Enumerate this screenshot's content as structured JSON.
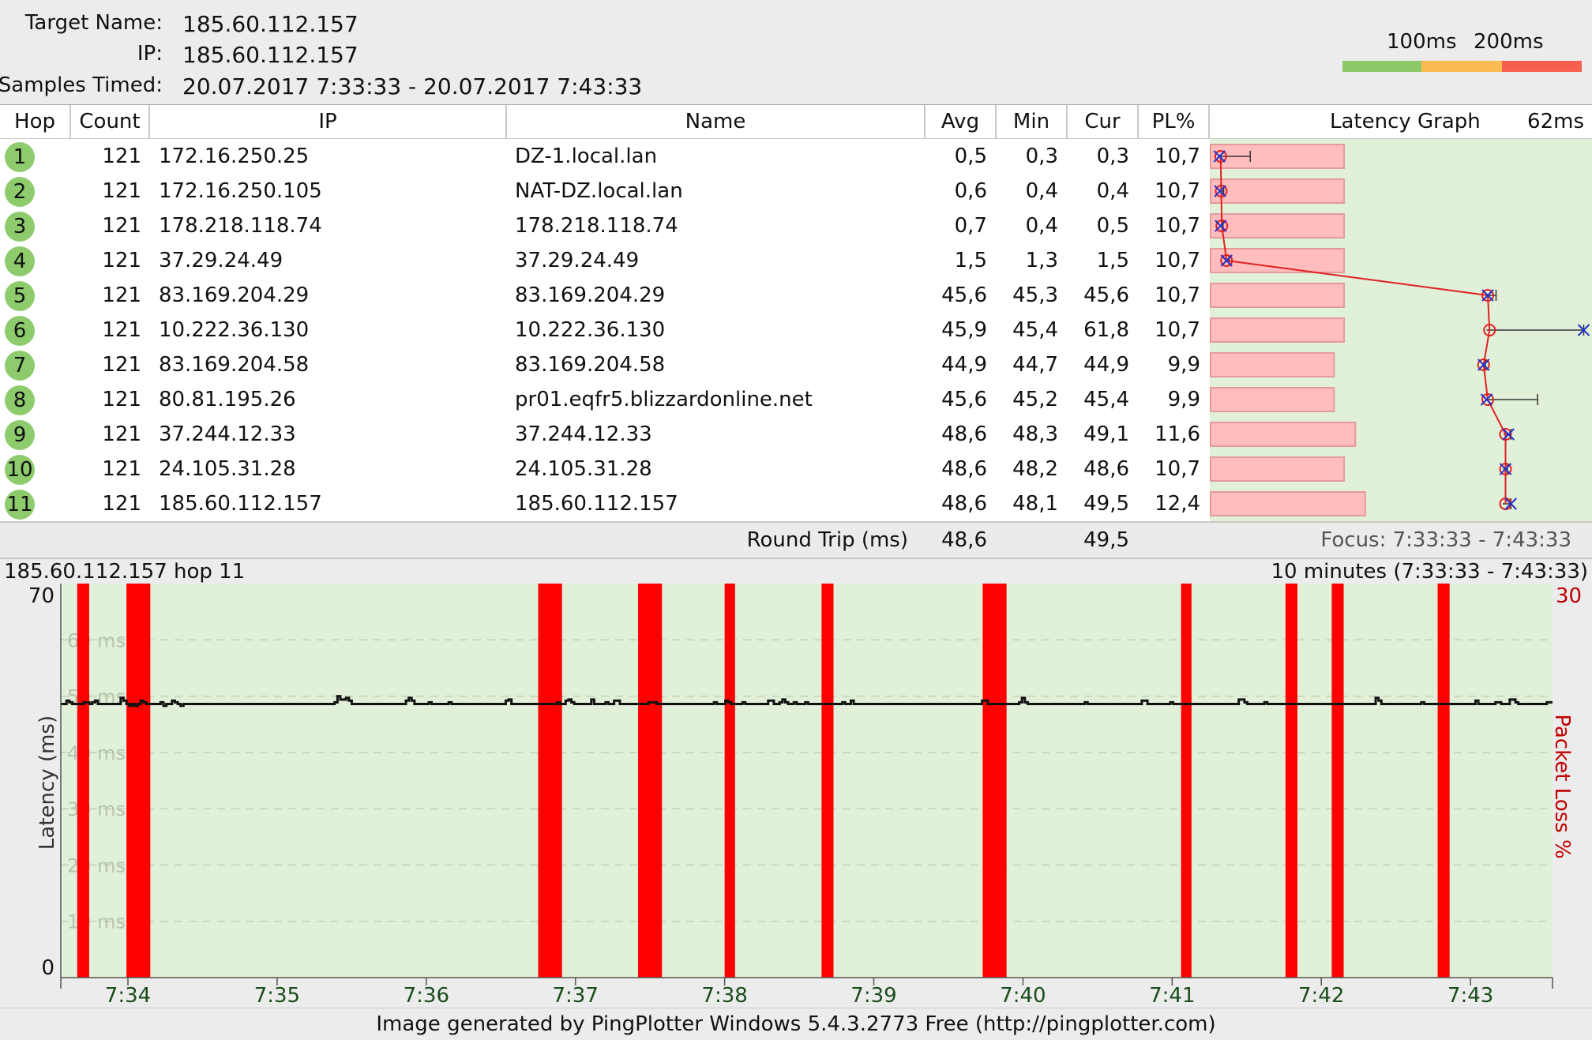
{
  "header": {
    "target_label": "Target Name:",
    "target_value": "185.60.112.157",
    "ip_label": "IP:",
    "ip_value": "185.60.112.157",
    "samples_label": "Samples Timed:",
    "samples_value": "20.07.2017 7:33:33 - 20.07.2017 7:43:33",
    "legend_100": "100ms",
    "legend_200": "200ms",
    "legend_colors": [
      "#8cc865",
      "#fbbb50",
      "#f5604e"
    ]
  },
  "table": {
    "columns": [
      "Hop",
      "Count",
      "IP",
      "Name",
      "Avg",
      "Min",
      "Cur",
      "PL%",
      "Latency Graph",
      "62ms"
    ],
    "rows": [
      {
        "hop": "1",
        "count": "121",
        "ip": "172.16.250.25",
        "name": "DZ-1.local.lan",
        "avg": "0,5",
        "min": "0,3",
        "cur": "0,3",
        "pl": "10,7"
      },
      {
        "hop": "2",
        "count": "121",
        "ip": "172.16.250.105",
        "name": "NAT-DZ.local.lan",
        "avg": "0,6",
        "min": "0,4",
        "cur": "0,4",
        "pl": "10,7"
      },
      {
        "hop": "3",
        "count": "121",
        "ip": "178.218.118.74",
        "name": "178.218.118.74",
        "avg": "0,7",
        "min": "0,4",
        "cur": "0,5",
        "pl": "10,7"
      },
      {
        "hop": "4",
        "count": "121",
        "ip": "37.29.24.49",
        "name": "37.29.24.49",
        "avg": "1,5",
        "min": "1,3",
        "cur": "1,5",
        "pl": "10,7"
      },
      {
        "hop": "5",
        "count": "121",
        "ip": "83.169.204.29",
        "name": "83.169.204.29",
        "avg": "45,6",
        "min": "45,3",
        "cur": "45,6",
        "pl": "10,7"
      },
      {
        "hop": "6",
        "count": "121",
        "ip": "10.222.36.130",
        "name": "10.222.36.130",
        "avg": "45,9",
        "min": "45,4",
        "cur": "61,8",
        "pl": "10,7"
      },
      {
        "hop": "7",
        "count": "121",
        "ip": "83.169.204.58",
        "name": "83.169.204.58",
        "avg": "44,9",
        "min": "44,7",
        "cur": "44,9",
        "pl": "9,9"
      },
      {
        "hop": "8",
        "count": "121",
        "ip": "80.81.195.26",
        "name": "pr01.eqfr5.blizzardonline.net",
        "avg": "45,6",
        "min": "45,2",
        "cur": "45,4",
        "pl": "9,9"
      },
      {
        "hop": "9",
        "count": "121",
        "ip": "37.244.12.33",
        "name": "37.244.12.33",
        "avg": "48,6",
        "min": "48,3",
        "cur": "49,1",
        "pl": "11,6"
      },
      {
        "hop": "10",
        "count": "121",
        "ip": "24.105.31.28",
        "name": "24.105.31.28",
        "avg": "48,6",
        "min": "48,2",
        "cur": "48,6",
        "pl": "10,7"
      },
      {
        "hop": "11",
        "count": "121",
        "ip": "185.60.112.157",
        "name": "185.60.112.157",
        "avg": "48,6",
        "min": "48,1",
        "cur": "49,5",
        "pl": "12,4"
      }
    ],
    "footer": {
      "label": "Round Trip (ms)",
      "avg": "48,6",
      "cur": "49,5",
      "focus": "Focus: 7:33:33 - 7:43:33"
    }
  },
  "latency_graph": {
    "scale_max_ms": 62,
    "hops": [
      {
        "avg": 0.5,
        "min": 0.3,
        "cur": 0.3,
        "max": 5.5,
        "pl": 10.7
      },
      {
        "avg": 0.6,
        "min": 0.4,
        "cur": 0.4,
        "max": 1.0,
        "pl": 10.7
      },
      {
        "avg": 0.7,
        "min": 0.4,
        "cur": 0.5,
        "max": 0.9,
        "pl": 10.7
      },
      {
        "avg": 1.5,
        "min": 1.3,
        "cur": 1.5,
        "max": 1.9,
        "pl": 10.7
      },
      {
        "avg": 45.6,
        "min": 45.3,
        "cur": 45.6,
        "max": 47.0,
        "pl": 10.7
      },
      {
        "avg": 45.9,
        "min": 45.4,
        "cur": 61.8,
        "max": 61.8,
        "pl": 10.7
      },
      {
        "avg": 44.9,
        "min": 44.7,
        "cur": 44.9,
        "max": 45.2,
        "pl": 9.9
      },
      {
        "avg": 45.6,
        "min": 45.2,
        "cur": 45.4,
        "max": 54.0,
        "pl": 9.9
      },
      {
        "avg": 48.6,
        "min": 48.3,
        "cur": 49.1,
        "max": 49.5,
        "pl": 11.6
      },
      {
        "avg": 48.6,
        "min": 48.2,
        "cur": 48.6,
        "max": 48.9,
        "pl": 10.7
      },
      {
        "avg": 48.6,
        "min": 48.1,
        "cur": 49.5,
        "max": 49.5,
        "pl": 12.4
      }
    ]
  },
  "chart_title_left": "185.60.112.157 hop 11",
  "chart_title_right": "10 minutes (7:33:33 - 7:43:33)",
  "chart_data": {
    "type": "line",
    "title": "185.60.112.157 hop 11",
    "ylabel": "Latency (ms)",
    "y2label": "Packet Loss %",
    "ylim": [
      0,
      70
    ],
    "y2lim": [
      0,
      30
    ],
    "y_axis_labels": [
      "70",
      "0"
    ],
    "y2_axis_label": "30",
    "grid_labels": [
      "60 ms",
      "50 ms",
      "40 ms",
      "30 ms",
      "20 ms",
      "10 ms"
    ],
    "grid_values": [
      60,
      50,
      40,
      30,
      20,
      10
    ],
    "xlim_minutes": [
      33.55,
      43.55
    ],
    "x_ticks": [
      "7:34",
      "7:35",
      "7:36",
      "7:37",
      "7:38",
      "7:39",
      "7:40",
      "7:41",
      "7:42",
      "7:43"
    ],
    "x_tick_minutes": [
      34,
      35,
      36,
      37,
      38,
      39,
      40,
      41,
      42,
      43
    ],
    "packet_loss_minutes": [
      [
        33.66,
        33.74
      ],
      [
        33.99,
        34.15
      ],
      [
        36.75,
        36.91
      ],
      [
        37.42,
        37.58
      ],
      [
        38.0,
        38.07
      ],
      [
        38.65,
        38.73
      ],
      [
        39.73,
        39.89
      ],
      [
        41.06,
        41.13
      ],
      [
        41.76,
        41.84
      ],
      [
        42.07,
        42.15
      ],
      [
        42.78,
        42.86
      ]
    ],
    "latency_ms": [
      48.6,
      48.6,
      49.2,
      48.9,
      48.6,
      48.6,
      48.6,
      48.6,
      48.9,
      48.9,
      48.6,
      48.9,
      49.2,
      48.6,
      48.6,
      48.6,
      48.6,
      48.6,
      48.6,
      48.6,
      48.6,
      49.7,
      49.2,
      48.6,
      48.3,
      48.6,
      48.3,
      48.6,
      49.2,
      48.9,
      48.6,
      48.6,
      48.6,
      48.6,
      48.6,
      48.9,
      48.3,
      48.6,
      48.6,
      49.2,
      48.9,
      48.6,
      48.3,
      48.6,
      48.6,
      48.6,
      48.6,
      48.6,
      48.6,
      48.6,
      48.6,
      48.6,
      48.6,
      48.6,
      48.6,
      48.6,
      48.6,
      48.6,
      48.6,
      48.6,
      48.6,
      48.6,
      48.6,
      48.6,
      48.6,
      48.6,
      48.6,
      48.6,
      48.6,
      48.6,
      48.6,
      48.6,
      48.6,
      48.6,
      48.6,
      48.6,
      48.6,
      48.6,
      48.6,
      48.6,
      48.6,
      48.6,
      48.6,
      48.6,
      48.6,
      48.6,
      48.6,
      48.6,
      48.6,
      48.6,
      48.6,
      48.6,
      48.6,
      48.6,
      48.6,
      48.6,
      48.9,
      50.0,
      49.4,
      49.4,
      49.7,
      49.2,
      48.6,
      48.6,
      48.6,
      48.6,
      48.6,
      48.6,
      48.6,
      48.6,
      48.6,
      48.6,
      48.6,
      48.6,
      48.6,
      48.6,
      48.6,
      48.6,
      48.6,
      48.6,
      48.6,
      49.2,
      49.7,
      49.2,
      48.6,
      48.6,
      48.6,
      48.6,
      48.6,
      48.9,
      48.6,
      48.6,
      48.6,
      48.6,
      48.6,
      48.6,
      48.9,
      48.6,
      48.6,
      48.6,
      48.6,
      48.6,
      48.6,
      48.6,
      48.6,
      48.6,
      48.6,
      48.6,
      48.6,
      48.6,
      48.6,
      48.6,
      48.6,
      48.6,
      48.6,
      48.6,
      49.2,
      49.4,
      48.6,
      48.6,
      48.6,
      48.6,
      48.6,
      48.6,
      48.6,
      48.6,
      48.6,
      48.6,
      48.6,
      48.6,
      48.6,
      48.6,
      48.6,
      48.6,
      48.9,
      48.6,
      48.6,
      49.2,
      49.4,
      48.9,
      48.6,
      48.6,
      48.6,
      48.6,
      48.6,
      48.6,
      49.4,
      48.6,
      48.6,
      48.6,
      48.6,
      48.9,
      48.6,
      48.6,
      49.2,
      49.2,
      48.6,
      48.6,
      48.6,
      48.6,
      48.6,
      48.6,
      48.6,
      48.6,
      48.6,
      48.6,
      48.9,
      48.9,
      48.9,
      48.6,
      48.6,
      48.6,
      48.6,
      48.6,
      48.6,
      48.6,
      48.6,
      48.6,
      48.6,
      48.6,
      48.6,
      48.6,
      48.6,
      48.6,
      48.6,
      48.6,
      48.6,
      48.6,
      48.6,
      48.9,
      48.6,
      48.6,
      48.6,
      49.2,
      48.9,
      48.6,
      48.6,
      48.6,
      48.6,
      48.9,
      48.6,
      48.6,
      48.6,
      48.6,
      48.6,
      48.6,
      48.6,
      48.6,
      49.2,
      49.2,
      48.6,
      48.6,
      48.9,
      49.4,
      48.9,
      48.6,
      48.6,
      48.9,
      48.6,
      48.6,
      48.6,
      48.9,
      48.6,
      48.6,
      48.6,
      48.6,
      48.6,
      48.6,
      48.6,
      48.6,
      48.6,
      48.6,
      48.6,
      48.6,
      48.9,
      48.6,
      48.6,
      49.2,
      48.6,
      48.6,
      48.6,
      48.6,
      48.6,
      48.6,
      48.6,
      48.6,
      48.6,
      48.6,
      48.6,
      48.6,
      48.6,
      48.6,
      48.6,
      48.6,
      48.6,
      48.6,
      48.6,
      48.6,
      48.6,
      48.6,
      48.6,
      48.6,
      48.6,
      48.6,
      48.6,
      48.6,
      48.6,
      48.6,
      48.6,
      48.6,
      48.6,
      48.6,
      48.6,
      48.6,
      48.6,
      48.6,
      48.6,
      48.6,
      48.6,
      48.6,
      48.6,
      48.6,
      48.6,
      49.2,
      49.2,
      48.6,
      48.6,
      48.6,
      48.6,
      48.6,
      48.6,
      48.6,
      48.6,
      48.6,
      48.6,
      48.6,
      48.9,
      49.7,
      48.9,
      48.6,
      48.6,
      48.6,
      48.6,
      48.6,
      48.6,
      48.6,
      48.6,
      48.6,
      48.6,
      48.6,
      48.6,
      48.6,
      48.6,
      48.6,
      48.6,
      48.6,
      48.6,
      48.6,
      48.6,
      48.9,
      48.6,
      48.6,
      48.6,
      48.6,
      48.6,
      48.6,
      48.6,
      48.6,
      48.6,
      48.6,
      48.6,
      48.6,
      48.6,
      48.6,
      48.6,
      48.6,
      48.6,
      48.6,
      48.6,
      49.2,
      49.2,
      48.6,
      48.6,
      48.6,
      48.6,
      48.6,
      48.6,
      48.6,
      48.6,
      48.9,
      48.6,
      48.6,
      48.6,
      48.6,
      48.6,
      48.6,
      48.6,
      48.6,
      48.6,
      48.6,
      48.6,
      48.6,
      48.6,
      48.6,
      48.6,
      48.6,
      48.6,
      48.6,
      48.6,
      48.6,
      48.6,
      48.6,
      48.6,
      49.4,
      49.4,
      48.9,
      48.6,
      48.6,
      48.6,
      48.6,
      48.6,
      48.6,
      48.9,
      48.6,
      48.6,
      48.6,
      48.6,
      48.6,
      48.6,
      48.6,
      48.6,
      48.6,
      48.6,
      48.6,
      48.6,
      48.6,
      48.6,
      48.6,
      48.6,
      48.6,
      48.6,
      48.6,
      48.6,
      48.6,
      48.6,
      48.6,
      48.6,
      48.6,
      48.6,
      48.6,
      48.6,
      48.6,
      48.6,
      48.6,
      48.6,
      48.6,
      48.6,
      48.6,
      48.6,
      48.6,
      48.6,
      49.7,
      49.2,
      48.6,
      48.6,
      48.6,
      48.6,
      48.6,
      48.6,
      48.6,
      48.6,
      48.6,
      48.6,
      48.6,
      48.6,
      48.6,
      48.6,
      48.9,
      48.6,
      48.6,
      48.6,
      48.6,
      48.6,
      48.6,
      48.6,
      48.6,
      48.6,
      48.6,
      48.6,
      48.6,
      48.6,
      48.6,
      48.6,
      48.6,
      48.6,
      48.6,
      49.2,
      48.6,
      48.6,
      48.6,
      48.6,
      48.6,
      48.6,
      48.9,
      48.9,
      48.6,
      48.6,
      48.6,
      49.4,
      49.4,
      48.9,
      48.6,
      48.6,
      48.6,
      48.6,
      48.6,
      48.6,
      48.6,
      48.6,
      48.6,
      48.6,
      48.9,
      48.9
    ]
  },
  "credit": "Image generated by PingPlotter Windows 5.4.3.2773 Free (http://pingplotter.com)"
}
